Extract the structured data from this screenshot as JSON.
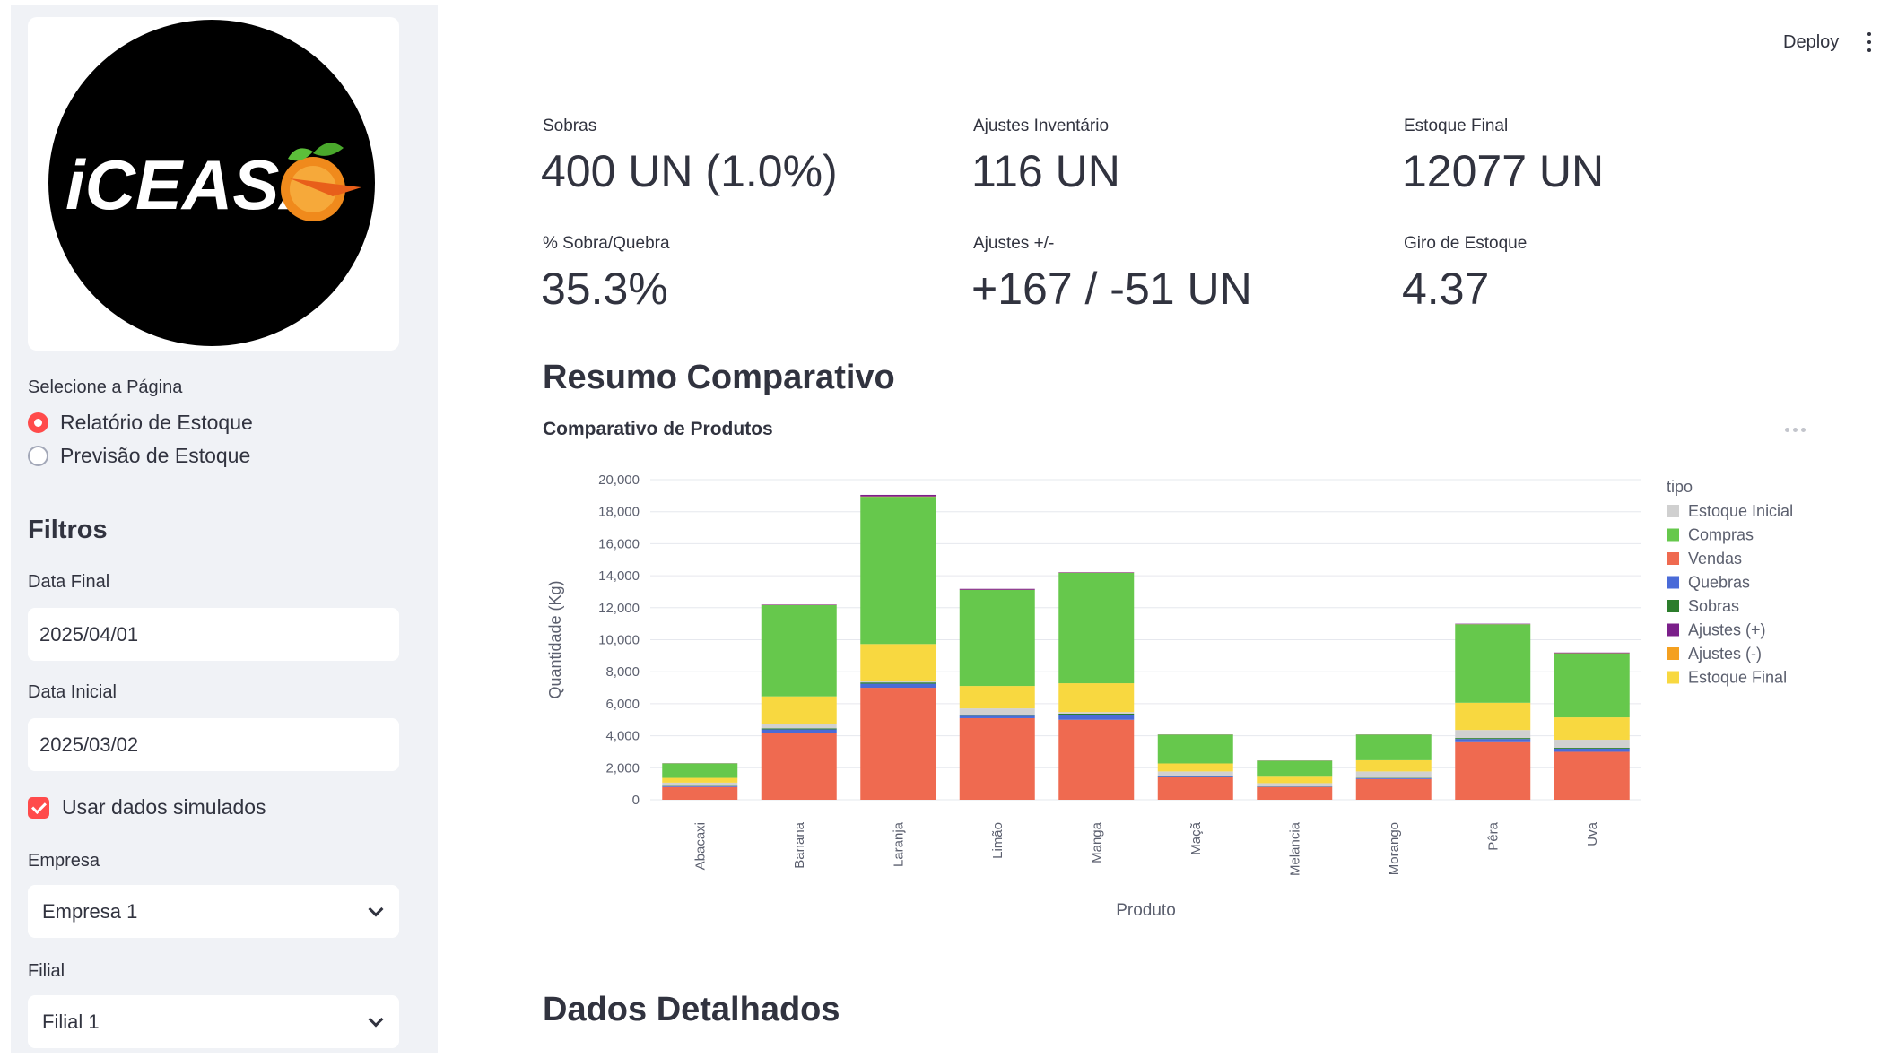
{
  "sidebar": {
    "logo_text": "iCEASA",
    "page_select_label": "Selecione a Página",
    "pages": [
      "Relatório de Estoque",
      "Previsão de Estoque"
    ],
    "selected_page": 0,
    "filters_heading": "Filtros",
    "data_final_label": "Data Final",
    "data_final_value": "2025/04/01",
    "data_inicial_label": "Data Inicial",
    "data_inicial_value": "2025/03/02",
    "simulated_label": "Usar dados simulados",
    "simulated_checked": true,
    "empresa_label": "Empresa",
    "empresa_value": "Empresa 1",
    "filial_label": "Filial",
    "filial_value": "Filial 1"
  },
  "header": {
    "deploy_label": "Deploy"
  },
  "metrics": [
    {
      "label": "Sobras",
      "value": "400 UN (1.0%)"
    },
    {
      "label": "Ajustes Inventário",
      "value": "116 UN"
    },
    {
      "label": "Estoque Final",
      "value": "12077 UN"
    },
    {
      "label": "% Sobra/Quebra",
      "value": "35.3%"
    },
    {
      "label": "Ajustes +/-",
      "value": "+167 / -51 UN"
    },
    {
      "label": "Giro de Estoque",
      "value": "4.37"
    }
  ],
  "sections": {
    "resumo_title": "Resumo Comparativo",
    "chart_title": "Comparativo de Produtos",
    "detalhados_title": "Dados Detalhados"
  },
  "colors": {
    "accent": "#ff4b4b",
    "sidebar_bg": "#f0f2f6",
    "text": "#31333f"
  },
  "chart_data": {
    "type": "bar",
    "stacked": true,
    "xlabel": "Produto",
    "ylabel": "Quantidade (Kg)",
    "ylim": [
      0,
      20000
    ],
    "yticks": [
      0,
      2000,
      4000,
      6000,
      8000,
      10000,
      12000,
      14000,
      16000,
      18000,
      20000
    ],
    "ytick_labels": [
      "0",
      "2,000",
      "4,000",
      "6,000",
      "8,000",
      "10,000",
      "12,000",
      "14,000",
      "16,000",
      "18,000",
      "20,000"
    ],
    "legend_title": "tipo",
    "legend_position": "right",
    "grid": true,
    "categories": [
      "Abacaxi",
      "Banana",
      "Laranja",
      "Limão",
      "Manga",
      "Maçã",
      "Melancia",
      "Morango",
      "Pêra",
      "Uva"
    ],
    "series": [
      {
        "name": "Vendas",
        "color": "#ef6a50",
        "values": [
          800,
          4200,
          7000,
          5100,
          5000,
          1400,
          800,
          1300,
          3600,
          3000
        ]
      },
      {
        "name": "Quebras",
        "color": "#4a6bd8",
        "values": [
          50,
          200,
          250,
          150,
          300,
          50,
          30,
          50,
          200,
          200
        ]
      },
      {
        "name": "Sobras",
        "color": "#2c7d2c",
        "values": [
          20,
          60,
          80,
          60,
          80,
          20,
          10,
          20,
          60,
          50
        ]
      },
      {
        "name": "Estoque Inicial",
        "color": "#d0d0d0",
        "values": [
          200,
          300,
          100,
          400,
          100,
          300,
          200,
          400,
          500,
          500
        ]
      },
      {
        "name": "Estoque Final",
        "color": "#f8d840",
        "values": [
          300,
          1700,
          2300,
          1400,
          1800,
          500,
          400,
          700,
          1700,
          1400
        ]
      },
      {
        "name": "Compras",
        "color": "#66c84c",
        "values": [
          900,
          5700,
          9200,
          6000,
          6900,
          1800,
          1000,
          1600,
          4900,
          4000
        ]
      },
      {
        "name": "Ajustes (-)",
        "color": "#f4a020",
        "values": [
          5,
          10,
          20,
          10,
          10,
          5,
          5,
          5,
          10,
          10
        ]
      },
      {
        "name": "Ajustes (+)",
        "color": "#7b1f8a",
        "values": [
          10,
          30,
          100,
          60,
          30,
          10,
          10,
          10,
          30,
          40
        ]
      }
    ],
    "legend_order": [
      "Estoque Inicial",
      "Compras",
      "Vendas",
      "Quebras",
      "Sobras",
      "Ajustes (+)",
      "Ajustes (-)",
      "Estoque Final"
    ]
  }
}
